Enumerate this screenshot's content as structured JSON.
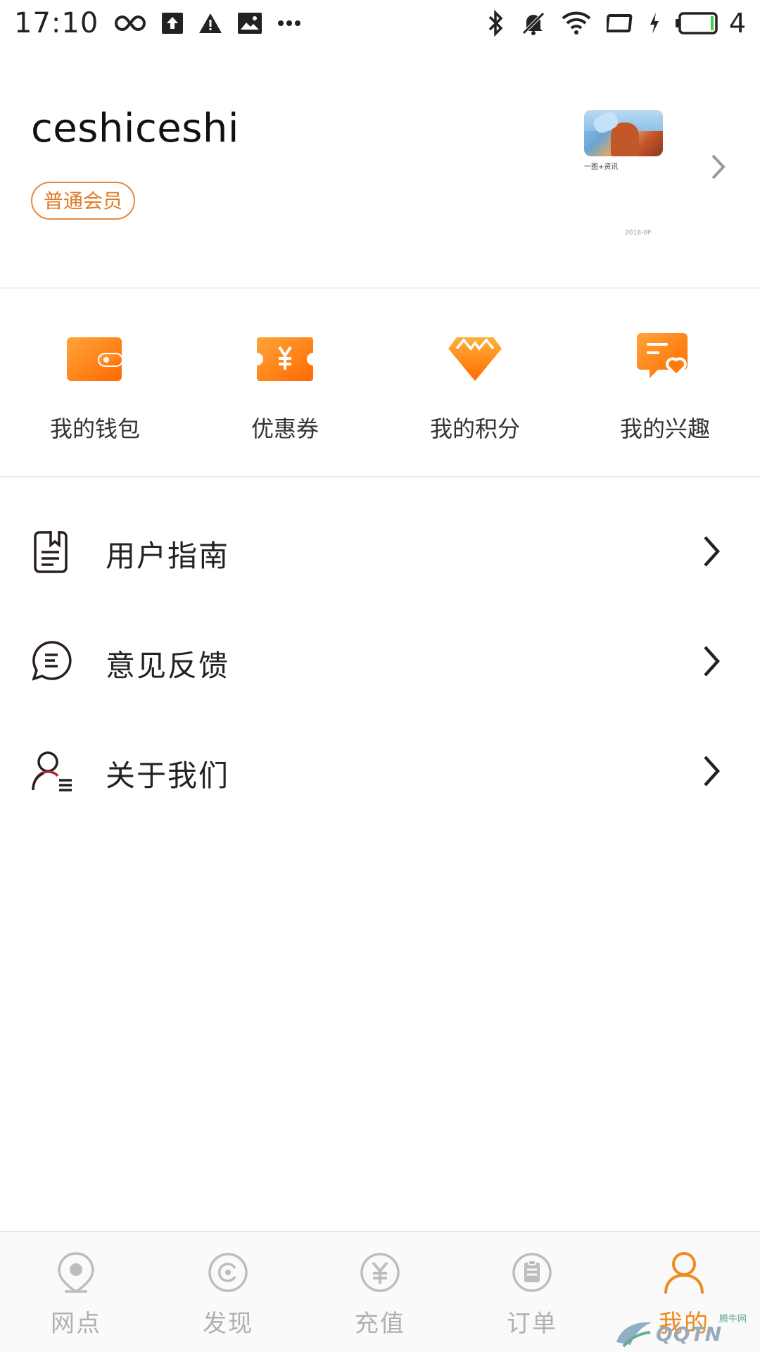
{
  "status_bar": {
    "time": "17:10",
    "battery_level": "4",
    "icons": [
      "infinity-icon",
      "upload-icon",
      "warning-icon",
      "image-icon",
      "more-icon",
      "bluetooth-icon",
      "mute-icon",
      "wifi-icon",
      "screen-rotate-icon",
      "charging-icon",
      "battery-icon"
    ]
  },
  "profile": {
    "username": "ceshiceshi",
    "member_badge": "普通会员",
    "thumbnail_caption": "一图+资讯",
    "thumbnail_date": "2018-0P"
  },
  "quick_actions": [
    {
      "label": "我的钱包",
      "icon": "wallet-icon"
    },
    {
      "label": "优惠券",
      "icon": "coupon-icon"
    },
    {
      "label": "我的积分",
      "icon": "diamond-icon"
    },
    {
      "label": "我的兴趣",
      "icon": "interest-icon"
    }
  ],
  "menu": [
    {
      "label": "用户指南",
      "icon": "guide-icon"
    },
    {
      "label": "意见反馈",
      "icon": "feedback-icon"
    },
    {
      "label": "关于我们",
      "icon": "about-icon"
    }
  ],
  "tabs": [
    {
      "label": "网点",
      "icon": "location-icon",
      "active": false
    },
    {
      "label": "发现",
      "icon": "discover-icon",
      "active": false
    },
    {
      "label": "充值",
      "icon": "recharge-icon",
      "active": false
    },
    {
      "label": "订单",
      "icon": "order-icon",
      "active": false
    },
    {
      "label": "我的",
      "icon": "profile-icon",
      "active": true
    }
  ],
  "watermark": {
    "text": "QQTN",
    "sub": "腾牛网"
  },
  "colors": {
    "accent": "#f08a1c",
    "inactive": "#b0b0b0",
    "badge_border": "#e38a3e"
  }
}
